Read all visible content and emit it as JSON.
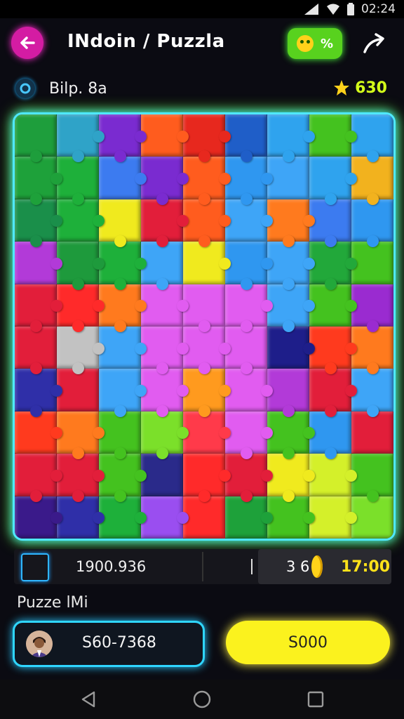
{
  "status_bar": {
    "time": "02:24"
  },
  "header": {
    "back_icon": "arrow-left-icon",
    "title": "INdoin / Puzzla",
    "emoji_button_label": "%",
    "share_icon": "share-icon"
  },
  "subheader": {
    "level_label": "Bilp. 8a",
    "star_score": "630"
  },
  "board": {
    "colors": [
      "#1e9e3c",
      "#2fa3c8",
      "#7a2bd0",
      "#ff5c1e",
      "#e7281e",
      "#1f5ec8",
      "#2fa3ee",
      "#44c21f",
      "#2fa3ee",
      "#1ea13a",
      "#1eb03a",
      "#3c7bf0",
      "#7a2bd0",
      "#ff5c1e",
      "#2f97f0",
      "#3ea5f7",
      "#2fa3ee",
      "#f2b21e",
      "#1a8f4a",
      "#1eb03a",
      "#f0ea1e",
      "#e21e3a",
      "#ff5c1e",
      "#3ea5f7",
      "#ff7a1e",
      "#3c7bf0",
      "#2f97f0",
      "#b23ad8",
      "#1e9a3c",
      "#1eb03a",
      "#3ea5f7",
      "#f0ea1e",
      "#2f97f0",
      "#3ea5f7",
      "#22a83a",
      "#44c21f",
      "#e21e3a",
      "#ff2a2a",
      "#ff7a1e",
      "#e15cf0",
      "#e15cf0",
      "#e15cf0",
      "#3ea5f7",
      "#44c21f",
      "#9a2bd0",
      "#e21e3a",
      "#c2c2c2",
      "#3ea5f7",
      "#e15cf0",
      "#e15cf0",
      "#e15cf0",
      "#1e1e8a",
      "#ff3a1e",
      "#ff7a1e",
      "#2f2fa8",
      "#e21e3a",
      "#3ea5f7",
      "#e15cf0",
      "#ff9a1e",
      "#e15cf0",
      "#b23ad8",
      "#e21e3a",
      "#3ea5f7",
      "#ff3a1e",
      "#ff7a1e",
      "#44c21f",
      "#7be02a",
      "#ff3a4a",
      "#e15cf0",
      "#44c21f",
      "#2f97f0",
      "#e21e3a",
      "#e21e3a",
      "#e21e3a",
      "#44c21f",
      "#2a2a8a",
      "#ff2a2a",
      "#e21e3a",
      "#f0ea1e",
      "#d4f02a",
      "#44c21f",
      "#3a1a8a",
      "#2f2fa8",
      "#1eb03a",
      "#9a4ef0",
      "#ff2a2a",
      "#1ea13a",
      "#44c21f",
      "#d4f02a",
      "#7be02a"
    ]
  },
  "info_bar": {
    "score": "1900.936",
    "divider_text": "|",
    "coin_count": "3 6",
    "timer": "17:00"
  },
  "section_label": "Puzze lMi",
  "player": {
    "code": "S60-7368"
  },
  "play_button": {
    "label": "S000"
  },
  "nav": {
    "back": "nav-back-icon",
    "home": "nav-home-icon",
    "recents": "nav-recents-icon"
  }
}
